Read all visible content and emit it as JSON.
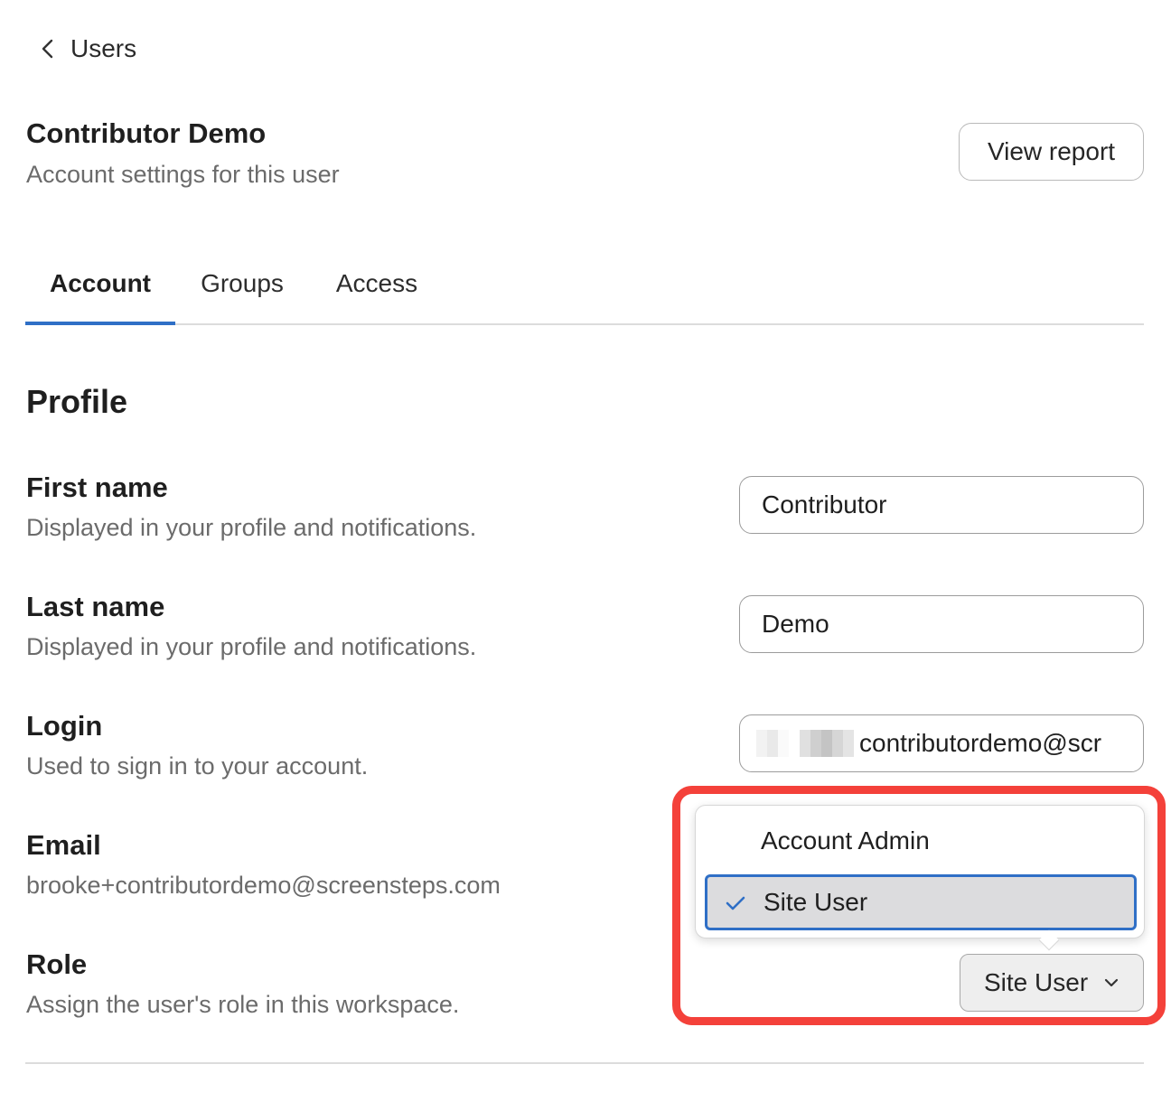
{
  "nav": {
    "back_label": "Users"
  },
  "header": {
    "title": "Contributor Demo",
    "subtitle": "Account settings for this user",
    "view_report_label": "View report"
  },
  "tabs": [
    {
      "label": "Account",
      "active": true
    },
    {
      "label": "Groups",
      "active": false
    },
    {
      "label": "Access",
      "active": false
    }
  ],
  "profile": {
    "section_title": "Profile",
    "first_name": {
      "label": "First name",
      "help": "Displayed in your profile and notifications.",
      "value": "Contributor"
    },
    "last_name": {
      "label": "Last name",
      "help": "Displayed in your profile and notifications.",
      "value": "Demo"
    },
    "login": {
      "label": "Login",
      "help": "Used to sign in to your account.",
      "value_visible": "contributordemo@scr"
    },
    "email": {
      "label": "Email",
      "value": "brooke+contributordemo@screensteps.com"
    },
    "role": {
      "label": "Role",
      "help": "Assign the user's role in this workspace.",
      "selected": "Site User",
      "options": [
        "Account Admin",
        "Site User"
      ]
    }
  },
  "colors": {
    "accent": "#2f6fc6",
    "highlight_frame": "#f4413a",
    "muted_text": "#6b6b6b"
  }
}
